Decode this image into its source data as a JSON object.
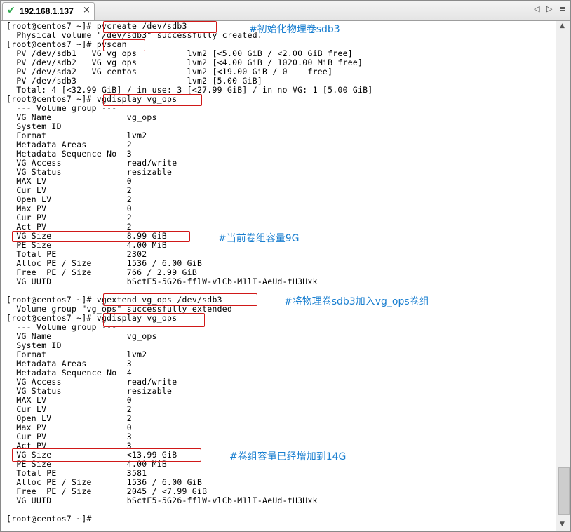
{
  "tab": {
    "title": "192.168.1.137",
    "close_glyph": "×",
    "status_icon": "check-icon"
  },
  "nav": {
    "prev": "◁",
    "next": "▷",
    "menu": "≡"
  },
  "terminal_lines": [
    "[root@centos7 ~]# pvcreate /dev/sdb3",
    "  Physical volume \"/dev/sdb3\" successfully created.",
    "[root@centos7 ~]# pvscan",
    "  PV /dev/sdb1   VG vg_ops          lvm2 [<5.00 GiB / <2.00 GiB free]",
    "  PV /dev/sdb2   VG vg_ops          lvm2 [<4.00 GiB / 1020.00 MiB free]",
    "  PV /dev/sda2   VG centos          lvm2 [<19.00 GiB / 0    free]",
    "  PV /dev/sdb3                      lvm2 [5.00 GiB]",
    "  Total: 4 [<32.99 GiB] / in use: 3 [<27.99 GiB] / in no VG: 1 [5.00 GiB]",
    "[root@centos7 ~]# vgdisplay vg_ops",
    "  --- Volume group ---",
    "  VG Name               vg_ops",
    "  System ID",
    "  Format                lvm2",
    "  Metadata Areas        2",
    "  Metadata Sequence No  3",
    "  VG Access             read/write",
    "  VG Status             resizable",
    "  MAX LV                0",
    "  Cur LV                2",
    "  Open LV               2",
    "  Max PV                0",
    "  Cur PV                2",
    "  Act PV                2",
    "  VG Size               8.99 GiB",
    "  PE Size               4.00 MiB",
    "  Total PE              2302",
    "  Alloc PE / Size       1536 / 6.00 GiB",
    "  Free  PE / Size       766 / 2.99 GiB",
    "  VG UUID               bSctE5-5G26-fflW-vlCb-M1lT-AeUd-tH3Hxk",
    "",
    "[root@centos7 ~]# vgextend vg_ops /dev/sdb3",
    "  Volume group \"vg_ops\" successfully extended",
    "[root@centos7 ~]# vgdisplay vg_ops",
    "  --- Volume group ---",
    "  VG Name               vg_ops",
    "  System ID",
    "  Format                lvm2",
    "  Metadata Areas        3",
    "  Metadata Sequence No  4",
    "  VG Access             read/write",
    "  VG Status             resizable",
    "  MAX LV                0",
    "  Cur LV                2",
    "  Open LV               2",
    "  Max PV                0",
    "  Cur PV                3",
    "  Act PV                3",
    "  VG Size               <13.99 GiB",
    "  PE Size               4.00 MiB",
    "  Total PE              3581",
    "  Alloc PE / Size       1536 / 6.00 GiB",
    "  Free  PE / Size       2045 / <7.99 GiB",
    "  VG UUID               bSctE5-5G26-fflW-vlCb-M1lT-AeUd-tH3Hxk",
    "",
    "[root@centos7 ~]#"
  ],
  "annotations": {
    "pvcreate": "#初始化物理卷sdb3",
    "size_before": "#当前卷组容量9G",
    "vgextend": "#将物理卷sdb3加入vg_ops卷组",
    "size_after": "#卷组容量已经增加到14G"
  },
  "colors": {
    "annotation": "#1a7fd0",
    "highlight_box": "#d01818",
    "terminal_text": "#000000",
    "terminal_bg": "#ffffff"
  },
  "scrollbar": {
    "up": "▲",
    "down": "▼"
  }
}
